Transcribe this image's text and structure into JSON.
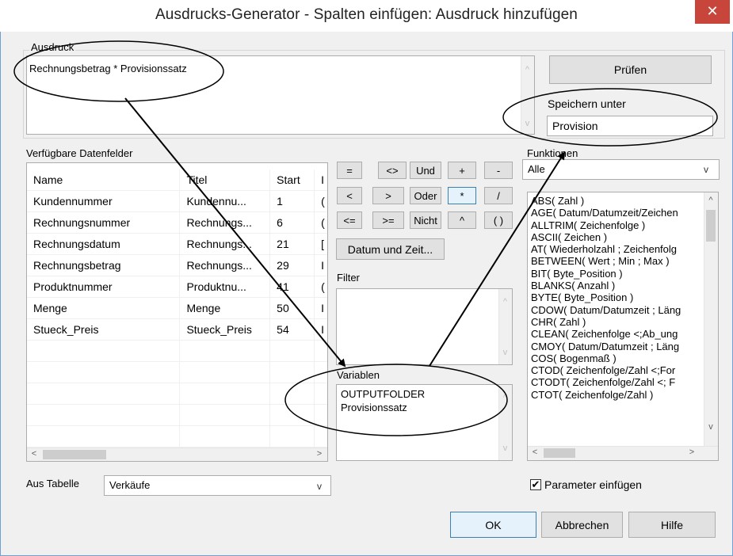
{
  "window": {
    "title": "Ausdrucks-Generator - Spalten einfügen: Ausdruck hinzufügen",
    "close_glyph": "✕"
  },
  "ausdruck": {
    "label": "Ausdruck",
    "value": "Rechnungsbetrag * Provisionssatz"
  },
  "pruefen_button": "Prüfen",
  "speichern": {
    "label": "Speichern unter",
    "value": "Provision"
  },
  "datenfelder": {
    "label": "Verfügbare Datenfelder",
    "columns": [
      "Name",
      "Titel",
      "Start",
      "I"
    ],
    "rows": [
      [
        "Kundennummer",
        "Kundennu...",
        "1",
        "("
      ],
      [
        "Rechnungsnummer",
        "Rechnungs...",
        "6",
        "("
      ],
      [
        "Rechnungsdatum",
        "Rechnungs...",
        "21",
        "["
      ],
      [
        "Rechnungsbetrag",
        "Rechnungs...",
        "29",
        "I"
      ],
      [
        "Produktnummer",
        "Produktnu...",
        "41",
        "("
      ],
      [
        "Menge",
        "Menge",
        "50",
        "I"
      ],
      [
        "Stueck_Preis",
        "Stueck_Preis",
        "54",
        "I"
      ]
    ]
  },
  "operators": {
    "row1": [
      "=",
      "<>",
      "Und",
      "+",
      "-"
    ],
    "row2": [
      "<",
      ">",
      "Oder",
      "*",
      "/"
    ],
    "row3": [
      "<=",
      ">=",
      "Nicht",
      "^",
      "( )"
    ]
  },
  "datum_button": "Datum und Zeit...",
  "filter_label": "Filter",
  "variablen": {
    "label": "Variablen",
    "items": [
      "OUTPUTFOLDER",
      "Provisionssatz"
    ]
  },
  "funktionen": {
    "label": "Funktionen",
    "selected": "Alle",
    "items": [
      "ABS( Zahl )",
      "AGE( Datum/Datumzeit/Zeichen",
      "ALLTRIM( Zeichenfolge )",
      "ASCII( Zeichen )",
      "AT( Wiederholzahl ; Zeichenfolg",
      "BETWEEN( Wert ; Min ; Max )",
      "BIT( Byte_Position )",
      "BLANKS( Anzahl )",
      "BYTE( Byte_Position )",
      "CDOW( Datum/Datumzeit ; Läng",
      "CHR( Zahl )",
      "CLEAN( Zeichenfolge <;Ab_ung",
      "CMOY( Datum/Datumzeit ; Läng",
      "COS( Bogenmaß )",
      "CTOD( Zeichenfolge/Zahl <;For",
      "CTODT( Zeichenfolge/Zahl <; F",
      "CTOT( Zeichenfolge/Zahl )"
    ]
  },
  "aus_tabelle": {
    "label": "Aus Tabelle",
    "selected": "Verkäufe"
  },
  "parameter": {
    "label": "Parameter einfügen",
    "checked_glyph": "✔"
  },
  "buttons": {
    "ok": "OK",
    "abbrechen": "Abbrechen",
    "hilfe": "Hilfe"
  },
  "icons": {
    "up": "^",
    "down": "v",
    "left": "<",
    "right": ">"
  }
}
